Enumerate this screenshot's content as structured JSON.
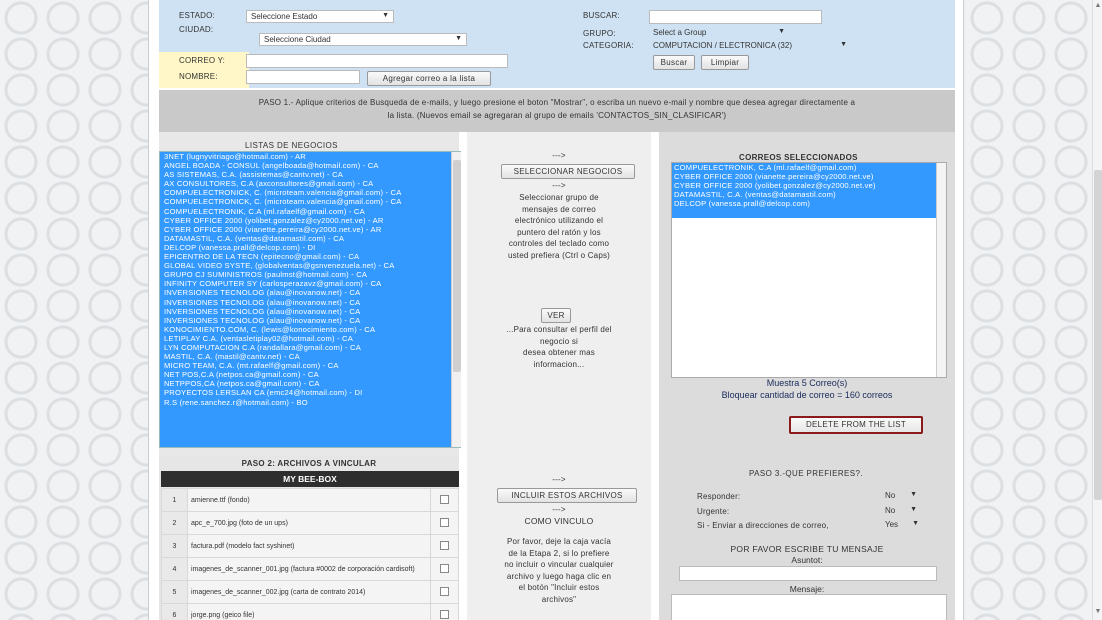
{
  "filters": {
    "estado_label": "ESTADO:",
    "estado_value": "Seleccione Estado",
    "ciudad_label": "CIUDAD:",
    "ciudad_value": "Seleccione Ciudad",
    "correo_label": "CORREO Y:",
    "nombre_label": "NOMBRE:",
    "agregar_button": "Agregar correo a la lista",
    "buscar_label": "BUSCAR:",
    "grupo_label": "GRUPO:",
    "grupo_value": "Select a Group",
    "categoria_label": "CATEGORIA:",
    "categoria_value": "COMPUTACION / ELECTRONICA (32)",
    "buscar_button": "Buscar",
    "limpiar_button": "Limpiar"
  },
  "paso1": {
    "line1": "PASO 1.- Aplique criterios de Busqueda de e-mails, y luego presione el boton \"Mostrar\", o escriba un nuevo e-mail y nombre que desea agregar directamente a",
    "line2": "la lista. (Nuevos email se agregaran al grupo de emails 'CONTACTOS_SIN_CLASIFICAR')"
  },
  "listas": {
    "title": "LISTAS DE NEGOCIOS",
    "items": [
      "3NET (lugnyvitriago@hotmail.com) - AR",
      "ANGEL BOADA - CONSUL (angelboada@hotmail.com) - CA",
      "AS SISTEMAS, C.A. (assistemas@cantv.net) - CA",
      "AX CONSULTORES, C.A (axconsultores@gmail.com) - CA",
      "COMPUELECTRONICK, C. (microteam.valencia@gmail.com) - CA",
      "COMPUELECTRONICK, C. (microteam.valencia@gmail.com) - CA",
      "COMPUELECTRONIK, C.A (ml.rafaelf@gmail.com) - CA",
      "CYBER OFFICE 2000 (yolibet.gonzalez@cy2000.net.ve) - AR",
      "CYBER OFFICE 2000 (vianette.pereira@cy2000.net.ve) - AR",
      "DATAMASTIL, C.A. (ventas@datamastil.com) - CA",
      "DELCOP (vanessa.prall@delcop.com) - DI",
      "EPICENTRO DE LA TECN (epitecno@gmail.com) - CA",
      "GLOBAL VIDEO SYSTE, (globalventas@gsnvenezuela.net) - CA",
      "GRUPO CJ SUMINISTROS (paulmst@hotmail.com) - CA",
      "INFINITY COMPUTER SY (carlosperazavz@gmail.com) - CA",
      "INVERSIONES TECNOLOG (alau@inovanow.net) - CA",
      "INVERSIONES TECNOLOG (alau@inovanow.net) - CA",
      "INVERSIONES TECNOLOG (alau@inovanow.net) - CA",
      "INVERSIONES TECNOLOG (alau@inovanow.net) - CA",
      "KONOCIMIENTO.COM, C. (lewis@konocimiento.com) - CA",
      "LETIPLAY C.A. (ventasletiplay02@hotmail.com) - CA",
      "LYN COMPUTACION C.A (randallara@gmail.com) - CA",
      "MASTIL, C.A. (mastil@cantv.net) - CA",
      "MICRO TEAM, C.A. (mt.rafaelf@gmail.com) - CA",
      "NET POS,C.A (netpos.ca@gmail.com) - CA",
      "NETPPOS,CA (netpos.ca@gmail.com) - CA",
      "PROYECTOS LERSLAN CA (emc24@hotmail.com) - DI",
      "R.S (rene.sanchez.r@hotmail.com) - BO"
    ]
  },
  "middle": {
    "arrow1": "--->",
    "seleccionar_button": "SELECCIONAR NEGOCIOS",
    "arrow2": "--->",
    "help_lines": [
      "Seleccionar grupo de",
      "mensajes de correo",
      "electrónico utilizando el",
      "puntero del ratón y los",
      "controles del teclado como",
      "usted prefiera (Ctrl o Caps)"
    ],
    "ver_button": "VER",
    "ver_lines": [
      "...Para consultar el perfil del",
      "negocio si",
      "desea obtener mas",
      "informacion..."
    ],
    "arrow3": "--->",
    "incluir_button": "INCLUIR ESTOS ARCHIVOS",
    "arrow4": "--->",
    "como_vinculo": "COMO VINCULO",
    "favor_lines": [
      "Por favor, deje la caja vacía",
      "de la Etapa 2, si lo prefiere",
      "no incluir o vincular cualquier",
      "archivo y luego haga clic en",
      "el botón \"Incluir estos",
      "archivos\""
    ]
  },
  "correos": {
    "title": "CORREOS SELECCIONADOS",
    "items": [
      "COMPUELECTRONIK, C.A (ml.rafaelf@gmail.com)",
      "CYBER OFFICE 2000 (vianette.pereira@cy2000.net.ve)",
      "CYBER OFFICE 2000 (yolibet.gonzalez@cy2000.net.ve)",
      "DATAMASTIL, C.A. (ventas@datamastil.com)",
      "DELCOP (vanessa.prall@delcop.com)"
    ],
    "muestra": "Muestra 5 Correo(s)",
    "bloquear": "Bloquear cantidad de correo = 160 correos",
    "delete_button": "DELETE FROM THE LIST"
  },
  "paso2": {
    "title": "PASO 2: ARCHIVOS A VINCULAR",
    "box_title": "MY BEE-BOX",
    "files": [
      {
        "n": "1",
        "name": "amienne.ttf (fondo)"
      },
      {
        "n": "2",
        "name": "apc_e_700.jpg (foto de un ups)"
      },
      {
        "n": "3",
        "name": "factura.pdf (modelo fact syshinet)"
      },
      {
        "n": "4",
        "name": "imagenes_de_scanner_001.jpg (factura #0002 de corporación cardisoft)"
      },
      {
        "n": "5",
        "name": "imagenes_de_scanner_002.jpg (carta de contrato 2014)"
      },
      {
        "n": "6",
        "name": "jorge.png (geico file)"
      }
    ]
  },
  "paso3": {
    "title": "PASO 3.-QUE PREFIERES?.",
    "responder_label": "Responder:",
    "responder_value": "No",
    "urgente_label": "Urgente:",
    "urgente_value": "No",
    "enviar_label": "Si - Enviar a direcciones de correo,",
    "enviar_value": "Yes",
    "mensaje_title": "POR FAVOR ESCRIBE TU MENSAJE",
    "asunto_label": "Asuntot:",
    "mensaje_label": "Mensaje:"
  },
  "colors": {
    "selection": "#3399ff",
    "filter_bg": "#cfe2f3",
    "delete_border": "#8b1a1a"
  }
}
